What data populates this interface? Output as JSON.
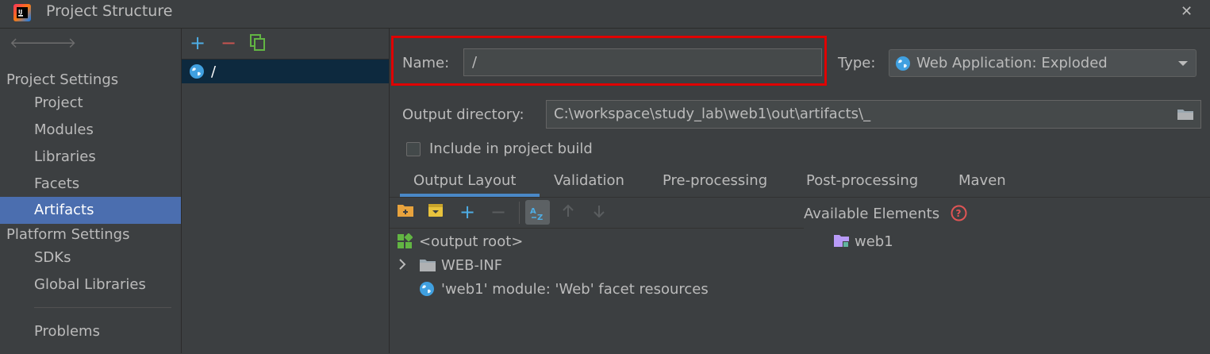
{
  "window": {
    "title": "Project Structure"
  },
  "left_nav": {
    "project_settings_header": "Project Settings",
    "project_items": [
      "Project",
      "Modules",
      "Libraries",
      "Facets",
      "Artifacts"
    ],
    "platform_settings_header": "Platform Settings",
    "platform_items": [
      "SDKs",
      "Global Libraries"
    ],
    "problems": "Problems",
    "selected": "Artifacts"
  },
  "artifacts": {
    "items": [
      {
        "name": "/"
      }
    ]
  },
  "form": {
    "name_label": "Name:",
    "name_value": "/",
    "type_label": "Type:",
    "type_value": "Web Application: Exploded",
    "output_dir_label": "Output directory:",
    "output_dir_value": "C:\\workspace\\study_lab\\web1\\out\\artifacts\\_",
    "include_label": "Include in project build",
    "include_checked": false
  },
  "tabs": [
    "Output Layout",
    "Validation",
    "Pre-processing",
    "Post-processing",
    "Maven"
  ],
  "active_tab": "Output Layout",
  "output_layout": {
    "tree": [
      {
        "label": "<output root>",
        "icon": "output-root-icon"
      },
      {
        "label": "WEB-INF",
        "icon": "folder-icon",
        "expandable": true
      },
      {
        "label": "'web1' module: 'Web' facet resources",
        "icon": "web-facet-icon"
      }
    ],
    "available_elements_label": "Available Elements",
    "available_elements": [
      {
        "label": "web1",
        "icon": "module-folder-icon"
      }
    ]
  },
  "colors": {
    "selection": "#4b6eaf",
    "highlight_border": "#e00000",
    "accent_blue": "#4a88c7"
  }
}
